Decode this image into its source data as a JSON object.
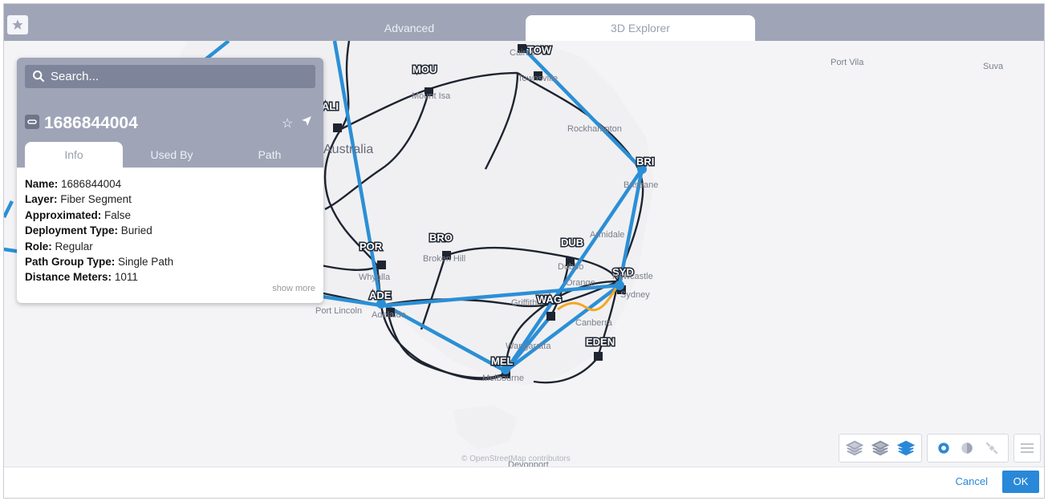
{
  "tabs": [
    "Advanced",
    "3D Explorer"
  ],
  "search": {
    "placeholder": "Search..."
  },
  "object": {
    "id": "1686844004"
  },
  "panel_tabs": [
    "Info",
    "Used By",
    "Path"
  ],
  "props": [
    {
      "key": "Name:",
      "val": "1686844004"
    },
    {
      "key": "Layer:",
      "val": "Fiber Segment"
    },
    {
      "key": "Approximated:",
      "val": "False"
    },
    {
      "key": "Deployment Type:",
      "val": "Buried"
    },
    {
      "key": "Role:",
      "val": "Regular"
    },
    {
      "key": "Path Group Type:",
      "val": "Single Path"
    },
    {
      "key": "Distance Meters:",
      "val": "1011"
    }
  ],
  "show_more": "show more",
  "footer": {
    "cancel": "Cancel",
    "ok": "OK"
  },
  "map": {
    "attribution": "© OpenStreetMap contributors",
    "places": [
      "Port Vila",
      "Suva",
      "Australia",
      "Port Lincoln",
      "Rockhampton",
      "Brisbane",
      "Armidale",
      "Newcastle",
      "Sydney",
      "Canberra",
      "Wangaratta",
      "Melbourne",
      "Mount Isa",
      "Townsville",
      "Broken Hill",
      "Whyalla",
      "Griffith",
      "Orange",
      "Devonport",
      "Cairns",
      "Adelaide",
      "Dubbo"
    ],
    "nodes": [
      "TOW",
      "MOU",
      "ALI",
      "BRI",
      "BRO",
      "DUB",
      "POR",
      "SYD",
      "ADE",
      "WAG",
      "EDEN",
      "MEL"
    ]
  },
  "colors": {
    "accent": "#2a88d8",
    "route": "#2b8fd6",
    "header": "#9fa5b7",
    "highlight": "#f5a623"
  },
  "icons": [
    "star-icon",
    "search-icon",
    "link-icon",
    "star-outline-icon",
    "locate-icon",
    "layers-icon",
    "gear-icon",
    "moon-icon",
    "satellite-icon",
    "menu-icon"
  ]
}
